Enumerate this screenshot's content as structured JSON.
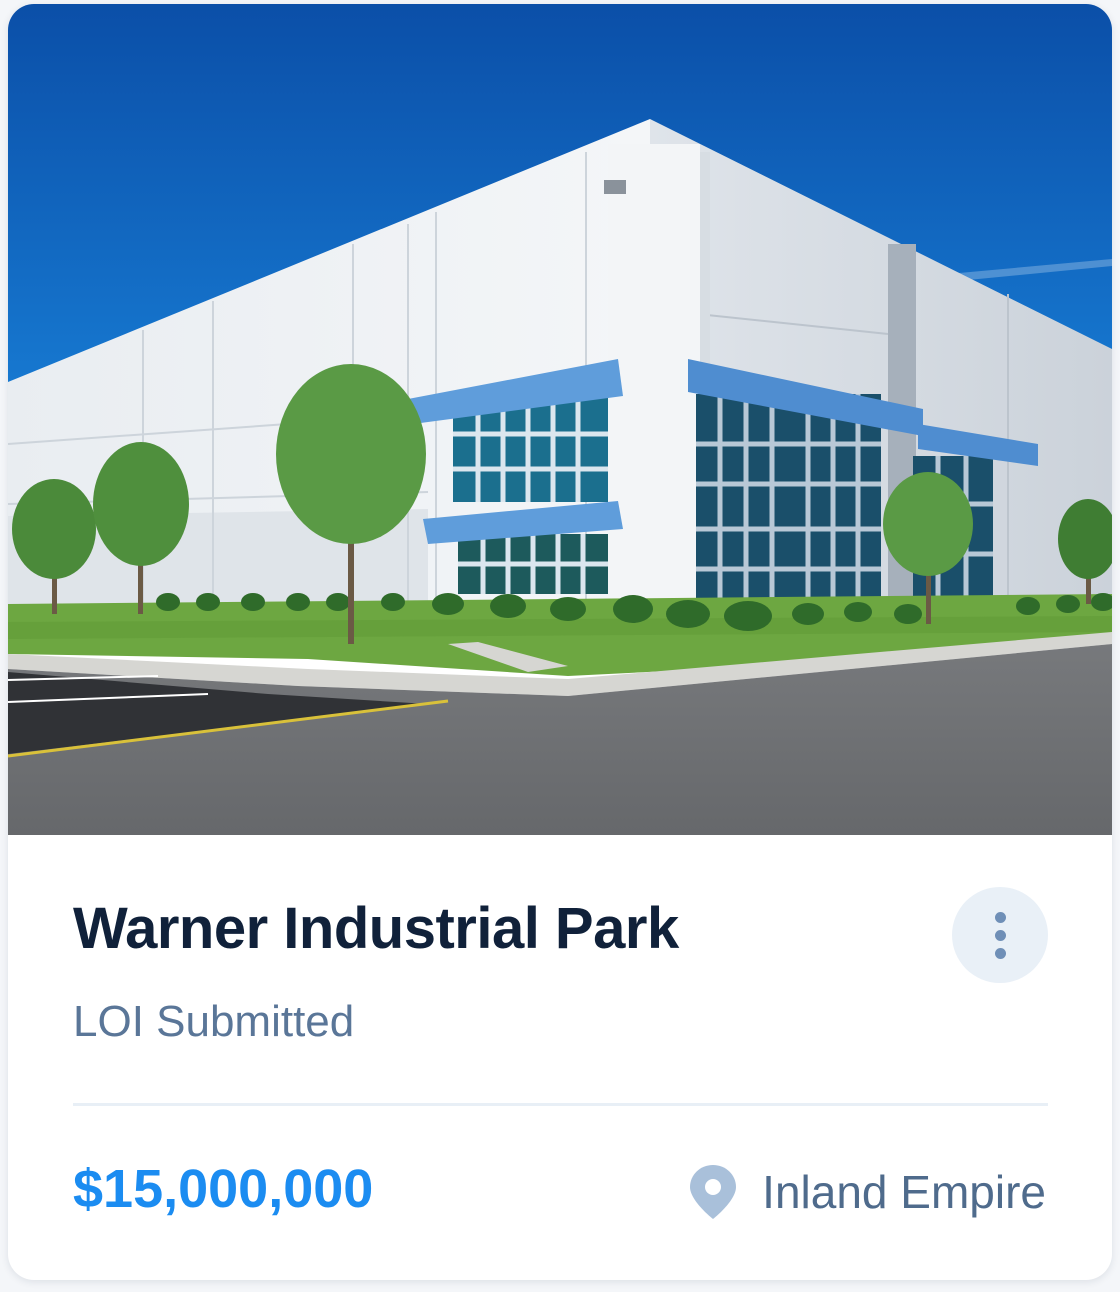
{
  "card": {
    "photo_alt": "Warner Industrial Park building",
    "title": "Warner Industrial Park",
    "status": "LOI Submitted",
    "price": "$15,000,000",
    "location": "Inland Empire",
    "icons": {
      "menu": "more-vertical-icon",
      "location": "map-pin-icon"
    },
    "colors": {
      "title": "#10213a",
      "status": "#5a7698",
      "price": "#1b8cf1",
      "location_text": "#4f6b8c",
      "menu_bg": "#e9f0f7",
      "icon": "#6f8fb7"
    }
  }
}
